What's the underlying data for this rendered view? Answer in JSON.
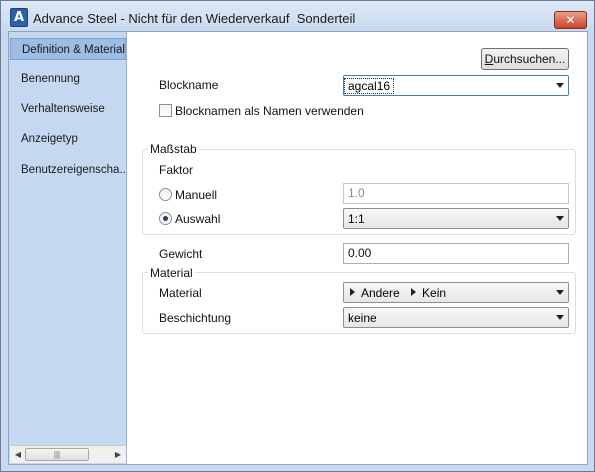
{
  "window": {
    "title": "Advance Steel - Nicht für den Wiederverkauf  Sonderteil",
    "app_icon": "A",
    "close_glyph": "✕"
  },
  "sidebar": {
    "items": [
      {
        "label": "Definition & Material",
        "active": true
      },
      {
        "label": "Benennung"
      },
      {
        "label": "Verhaltensweise"
      },
      {
        "label": "Anzeigetyp"
      },
      {
        "label": "Benutzereigenscha..."
      }
    ],
    "scroll_left": "◀",
    "scroll_right": "▶",
    "scroll_thumb": "|||"
  },
  "main": {
    "browse_button": {
      "underlined": "D",
      "rest": "urchsuchen..."
    },
    "blockname_label": "Blockname",
    "blockname_value": "agcal16",
    "use_blockname_label": "Blocknamen als Namen verwenden",
    "use_blockname_checked": false,
    "scale_group": {
      "title": "Maßstab",
      "factor_label": "Faktor",
      "manual_label": "Manuell",
      "manual_value": "1.0",
      "selection_label": "Auswahl",
      "selection_value": "1:1",
      "selected": "Auswahl"
    },
    "weight_label": "Gewicht",
    "weight_value": "0.00",
    "material_group": {
      "title": "Material",
      "material_label": "Material",
      "material_path": [
        "Andere",
        "Kein"
      ],
      "coating_label": "Beschichtung",
      "coating_value": "keine"
    }
  },
  "colors": {
    "sidebar_bg": "#c5d8f1",
    "sidebar_active": "#9cbde6",
    "close_button": "#c7432a"
  }
}
